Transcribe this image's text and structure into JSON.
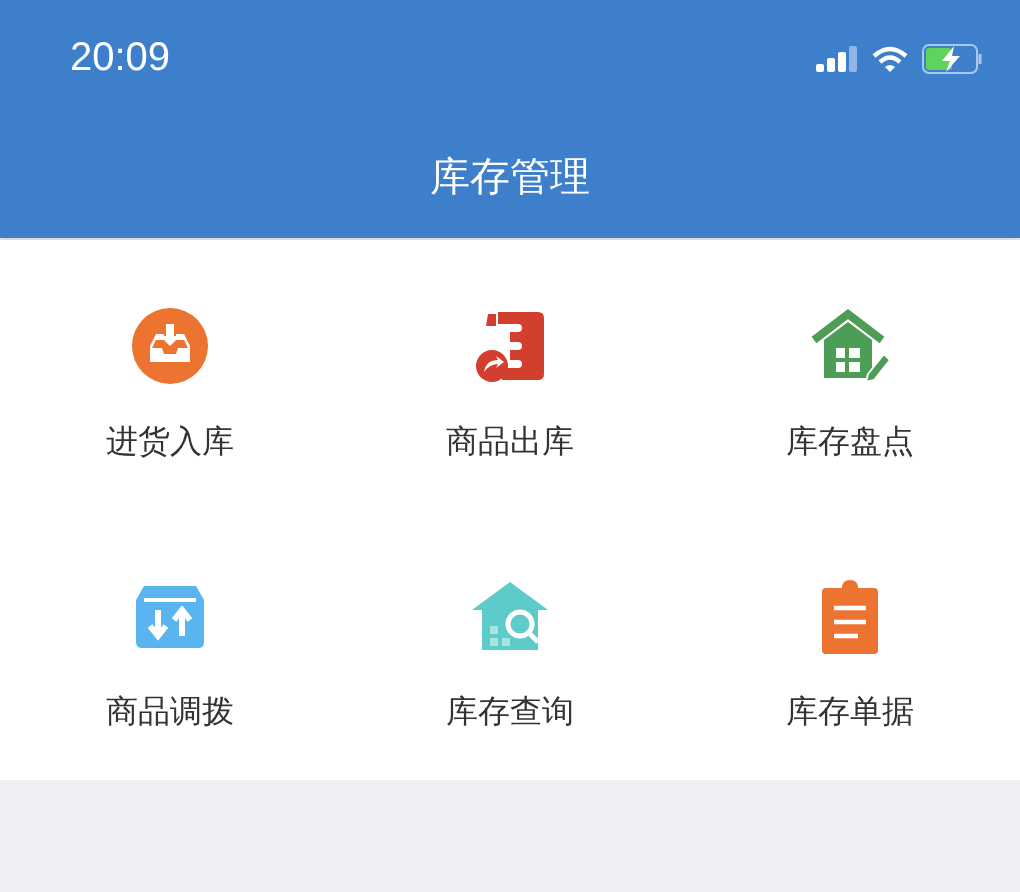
{
  "status_bar": {
    "time": "20:09"
  },
  "nav_bar": {
    "title": "库存管理"
  },
  "menu_items": [
    {
      "label": "进货入库"
    },
    {
      "label": "商品出库"
    },
    {
      "label": "库存盘点"
    },
    {
      "label": "商品调拨"
    },
    {
      "label": "库存查询"
    },
    {
      "label": "库存单据"
    }
  ]
}
